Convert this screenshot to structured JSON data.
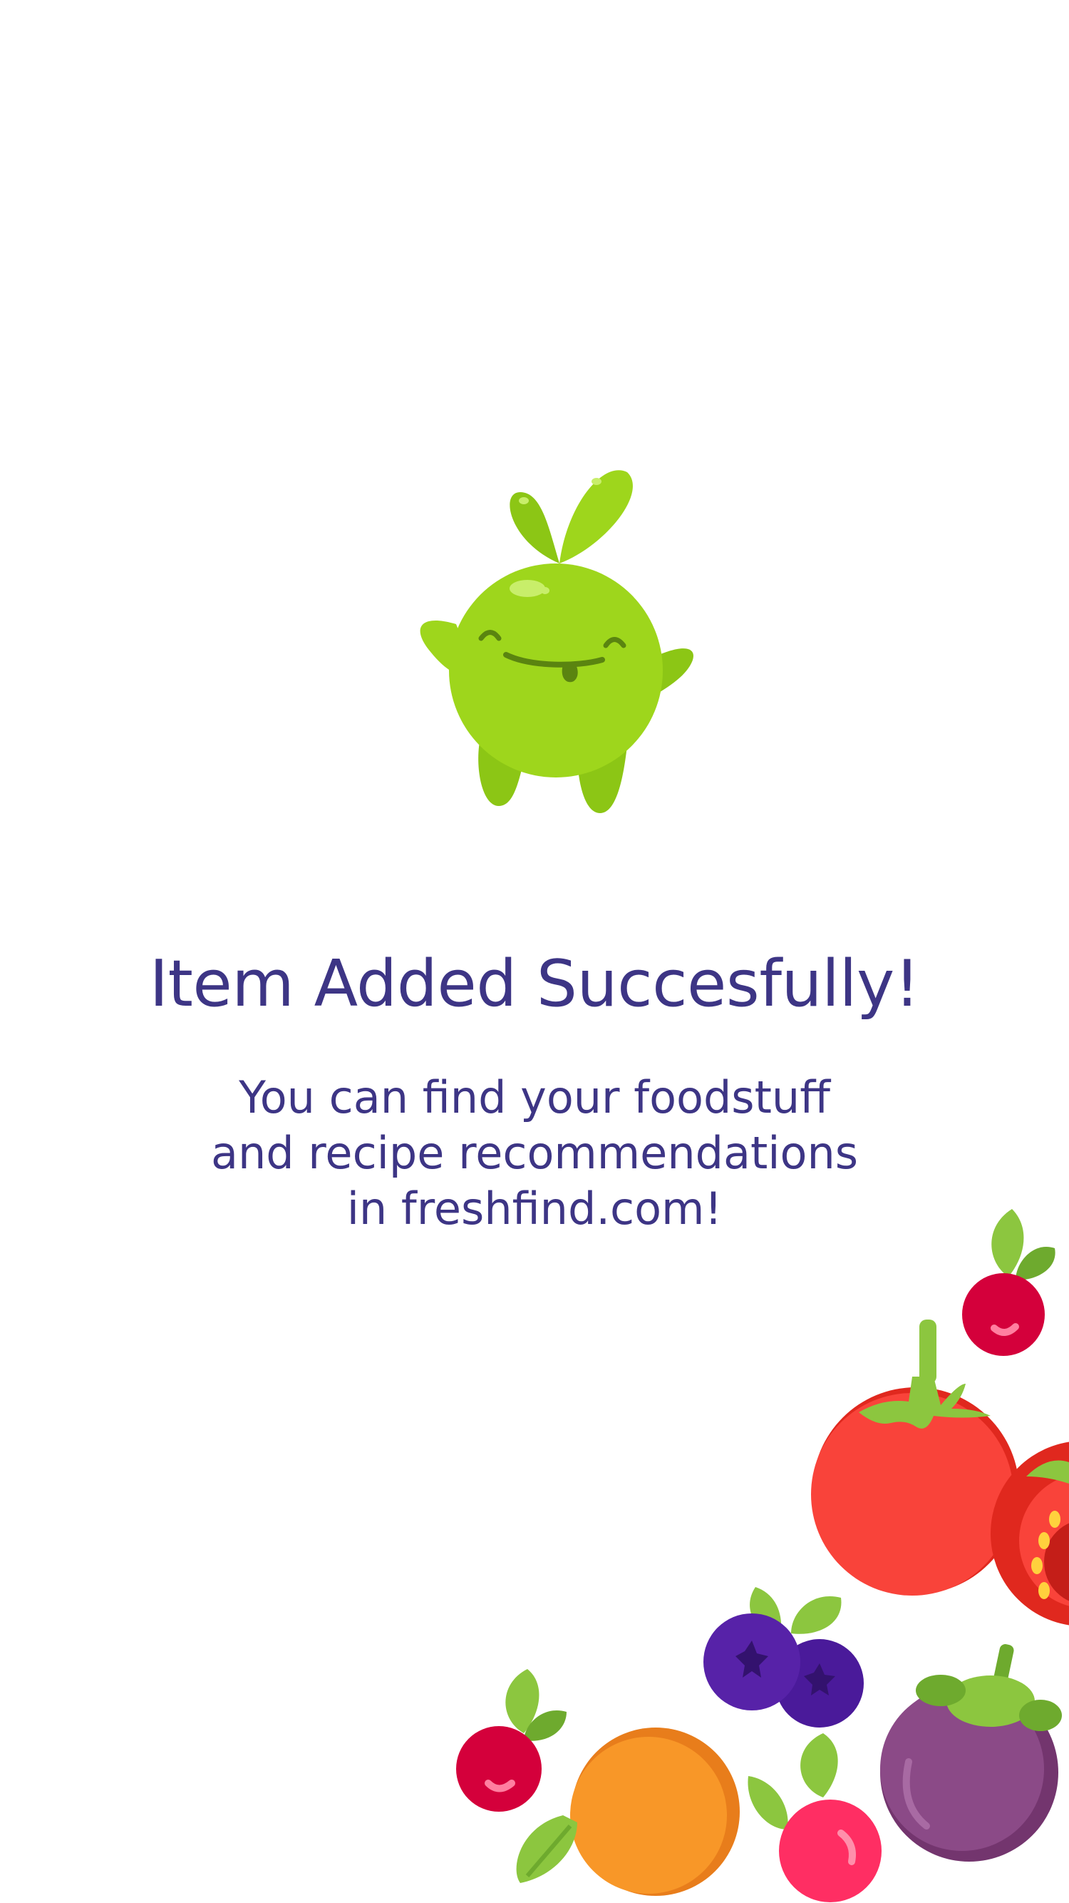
{
  "success": {
    "title": "Item Added Succesfully!",
    "message_lines": [
      "You can find your foodstuff",
      "and recipe recommendations",
      "in freshfind.com!"
    ]
  },
  "mascot": {
    "icon": "sprout-mascot-icon",
    "color": "#9ed61c"
  },
  "decoration": {
    "icons": [
      "cherry-icon",
      "tomato-icon",
      "blueberry-icon",
      "orange-icon",
      "mangosteen-icon"
    ]
  },
  "theme": {
    "text_color": "#3d3585",
    "background": "#ffffff"
  }
}
